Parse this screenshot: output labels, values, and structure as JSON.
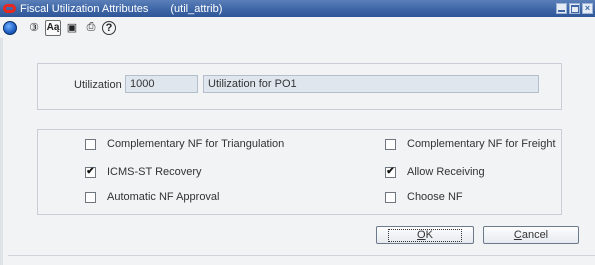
{
  "window": {
    "title": "Fiscal Utilization Attributes",
    "form_id": "(util_attrib)"
  },
  "toolbar": {
    "icons": [
      "globe-icon",
      "spell-icon",
      "text-case-icon",
      "copy-icon",
      "print-icon",
      "help-icon"
    ],
    "glyphs": {
      "spell": "③",
      "text_case": "Aą",
      "copy": "▣",
      "print": "⎙",
      "help": "?"
    }
  },
  "utilization": {
    "label": "Utilization",
    "code": "1000",
    "description": "Utilization for PO1"
  },
  "options": [
    {
      "label": "Complementary NF for Triangulation",
      "checked": false
    },
    {
      "label": "Complementary NF for Freight",
      "checked": false
    },
    {
      "label": "ICMS-ST Recovery",
      "checked": true
    },
    {
      "label": "Allow Receiving",
      "checked": true
    },
    {
      "label": "Automatic NF Approval",
      "checked": false
    },
    {
      "label": "Choose NF",
      "checked": false
    }
  ],
  "buttons": {
    "ok_first": "O",
    "ok_rest": "K",
    "cancel_first": "C",
    "cancel_rest": "ancel"
  },
  "colors": {
    "titlebar": "#3e66a6",
    "field_bg": "#dfe6ee",
    "window_bg": "#f1f3f5"
  }
}
